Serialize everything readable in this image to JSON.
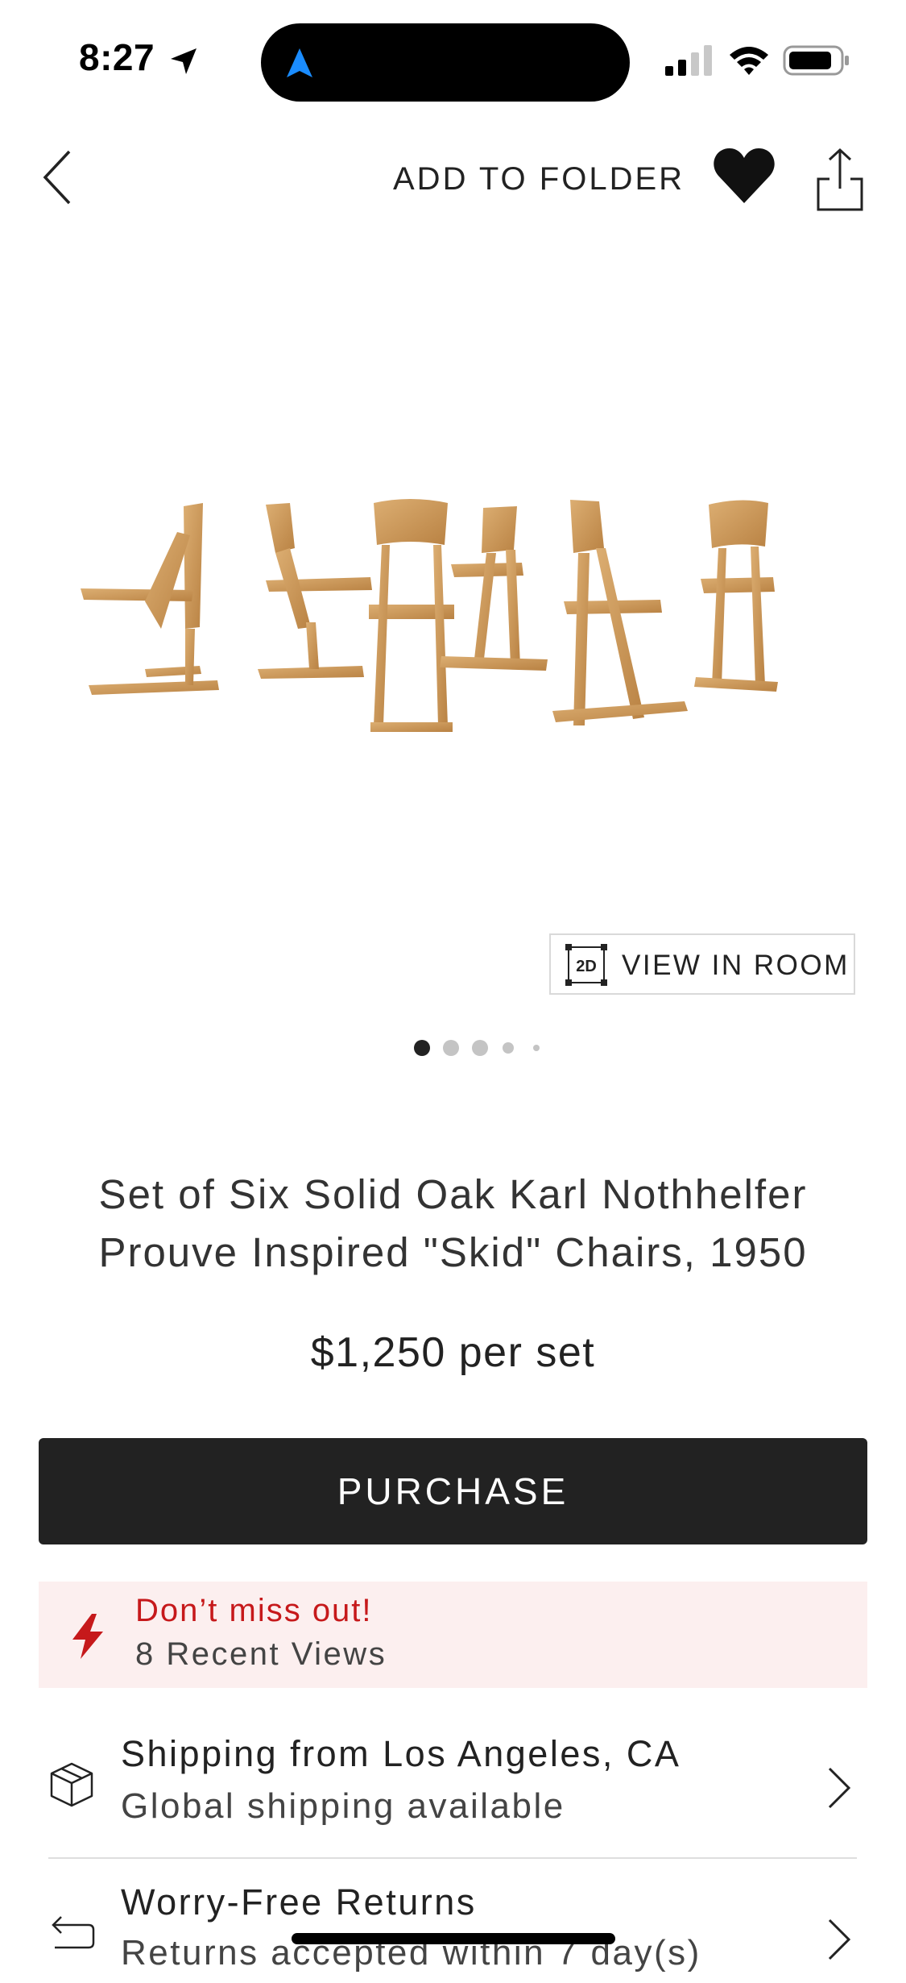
{
  "status_bar": {
    "time": "8:27"
  },
  "header": {
    "add_to_folder": "ADD TO FOLDER"
  },
  "gallery": {
    "view_in_room_badge": "2D",
    "view_in_room": "VIEW IN ROOM",
    "page_count": 5,
    "current_page": 1
  },
  "product": {
    "title": "Set of Six Solid Oak Karl Nothhelfer Prouve Inspired \"Skid\" Chairs, 1950",
    "price": "$1,250 per set",
    "purchase_label": "PURCHASE"
  },
  "alert": {
    "title": "Don’t miss out!",
    "subtitle": "8 Recent Views"
  },
  "shipping": {
    "title": "Shipping from Los Angeles, CA",
    "subtitle": "Global shipping available"
  },
  "returns": {
    "title": "Worry-Free Returns",
    "subtitle": "Returns accepted within 7 day(s)"
  },
  "colors": {
    "accent_dark": "#222222",
    "alert_red": "#c6191b",
    "alert_bg": "#fcefef",
    "nav_blue": "#1a8cff"
  }
}
